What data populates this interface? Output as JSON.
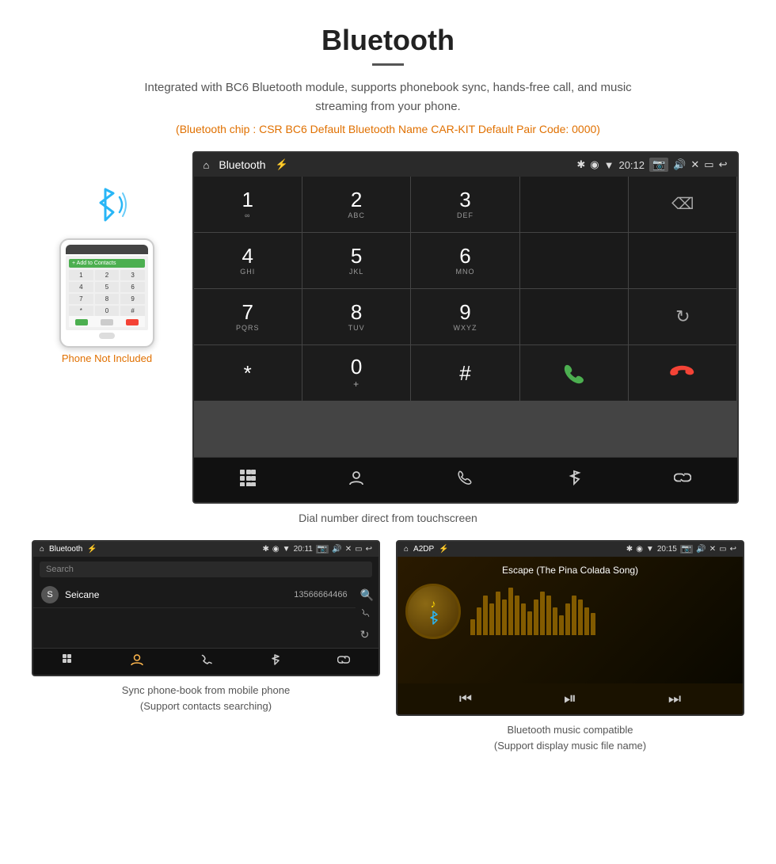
{
  "page": {
    "title": "Bluetooth",
    "subtitle": "Integrated with BC6 Bluetooth module, supports phonebook sync, hands-free call, and music streaming from your phone.",
    "specs": "(Bluetooth chip : CSR BC6    Default Bluetooth Name CAR-KIT    Default Pair Code: 0000)",
    "dial_caption": "Dial number direct from touchscreen",
    "phone_label": "Phone Not Included",
    "phonebook_caption": "Sync phone-book from mobile phone\n(Support contacts searching)",
    "music_caption": "Bluetooth music compatible\n(Support display music file name)"
  },
  "car_screen": {
    "topbar": {
      "home_icon": "⌂",
      "title": "Bluetooth",
      "usb_icon": "⚡",
      "bt_icon": "✱",
      "location_icon": "◉",
      "wifi_icon": "▼",
      "time": "20:12",
      "camera_icon": "📷",
      "volume_icon": "🔊",
      "close_icon": "✕",
      "window_icon": "▭",
      "back_icon": "↩"
    },
    "dialpad": [
      {
        "num": "1",
        "letters": "∞",
        "col": 1,
        "row": 1
      },
      {
        "num": "2",
        "letters": "ABC",
        "col": 2,
        "row": 1
      },
      {
        "num": "3",
        "letters": "DEF",
        "col": 3,
        "row": 1
      },
      {
        "num": "",
        "letters": "",
        "col": 4,
        "row": 1,
        "type": "empty"
      },
      {
        "num": "⌫",
        "letters": "",
        "col": 5,
        "row": 1,
        "type": "backspace"
      },
      {
        "num": "4",
        "letters": "GHI",
        "col": 1,
        "row": 2
      },
      {
        "num": "5",
        "letters": "JKL",
        "col": 2,
        "row": 2
      },
      {
        "num": "6",
        "letters": "MNO",
        "col": 3,
        "row": 2
      },
      {
        "num": "",
        "letters": "",
        "col": 4,
        "row": 2,
        "type": "empty"
      },
      {
        "num": "",
        "letters": "",
        "col": 5,
        "row": 2,
        "type": "empty"
      },
      {
        "num": "7",
        "letters": "PQRS",
        "col": 1,
        "row": 3
      },
      {
        "num": "8",
        "letters": "TUV",
        "col": 2,
        "row": 3
      },
      {
        "num": "9",
        "letters": "WXYZ",
        "col": 3,
        "row": 3
      },
      {
        "num": "",
        "letters": "",
        "col": 4,
        "row": 3,
        "type": "empty"
      },
      {
        "num": "↻",
        "letters": "",
        "col": 5,
        "row": 3,
        "type": "refresh"
      },
      {
        "num": "*",
        "letters": "",
        "col": 1,
        "row": 4
      },
      {
        "num": "0",
        "letters": "+",
        "col": 2,
        "row": 4
      },
      {
        "num": "#",
        "letters": "",
        "col": 3,
        "row": 4
      },
      {
        "num": "📞",
        "letters": "",
        "col": 4,
        "row": 4,
        "type": "action-green"
      },
      {
        "num": "📵",
        "letters": "",
        "col": 5,
        "row": 4,
        "type": "action-red"
      }
    ],
    "bottom_toolbar_icons": [
      "⊞",
      "👤",
      "📞",
      "✱",
      "🔗"
    ]
  },
  "phonebook_screen": {
    "topbar_title": "Bluetooth",
    "time": "20:11",
    "search_placeholder": "Search",
    "contacts": [
      {
        "initial": "S",
        "name": "Seicane",
        "number": "13566664466"
      }
    ],
    "right_icons": [
      "🔍",
      "📞",
      "↻"
    ],
    "bottom_toolbar_icons": [
      "⊞",
      "👤",
      "📞",
      "✱",
      "🔗"
    ]
  },
  "music_screen": {
    "topbar_title": "A2DP",
    "time": "20:15",
    "song_title": "Escape (The Pina Colada Song)",
    "viz_bars": [
      20,
      35,
      50,
      40,
      55,
      45,
      60,
      50,
      40,
      30,
      45,
      55,
      50,
      35,
      25,
      40,
      50,
      45,
      35,
      28
    ],
    "controls": [
      "⏮",
      "⏯",
      "⏭"
    ]
  },
  "phone_mock": {
    "contacts_label": "+ Add to Contacts",
    "keys": [
      "1",
      "2",
      "3",
      "4",
      "5",
      "6",
      "7",
      "8",
      "9",
      "*",
      "0",
      "#"
    ]
  }
}
